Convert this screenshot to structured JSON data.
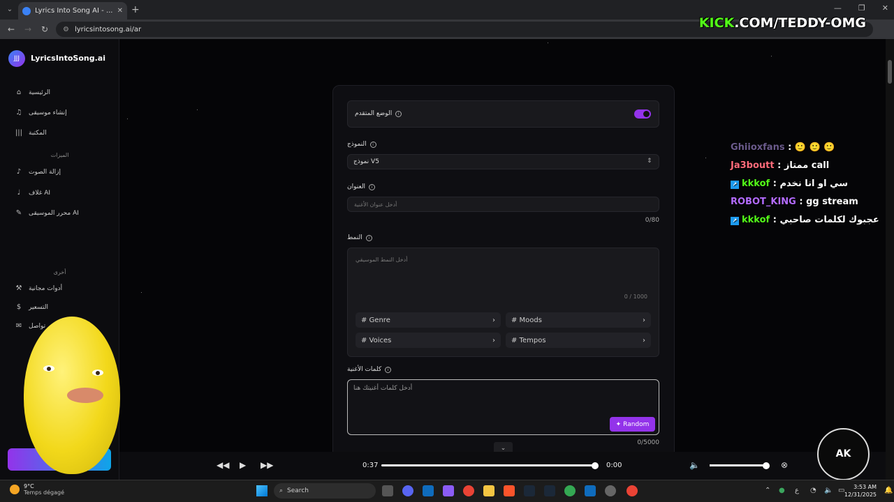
{
  "browser": {
    "tab_title": "Lyrics Into Song AI - ...بر الإنترنت",
    "url": "lyricsintosong.ai/ar"
  },
  "overlay": {
    "kick_prefix": "KICK",
    "kick_suffix": ".COM/TEDDY-OMG",
    "eagle_text": "AK"
  },
  "sidebar": {
    "brand": "LyricsIntoSong.ai",
    "logo": "JJJ",
    "items": [
      {
        "label": "الرئيسية",
        "icon": "home-icon"
      },
      {
        "label": "إنشاء موسيقى",
        "icon": "music-icon"
      },
      {
        "label": "المكتبة",
        "icon": "library-icon"
      }
    ],
    "features_heading": "الميزات",
    "features": [
      {
        "label": "إزالة الصوت",
        "icon": "vocal-remover-icon"
      },
      {
        "label": "غلاف AI",
        "icon": "cover-icon"
      },
      {
        "label": "محرر الموسيقى AI",
        "icon": "editor-icon"
      }
    ],
    "other_heading": "أخرى",
    "other": [
      {
        "label": "أدوات مجانية",
        "icon": "tools-icon"
      },
      {
        "label": "التسعير",
        "icon": "dollar-icon"
      },
      {
        "label": "تواصل",
        "icon": "mail-icon"
      }
    ]
  },
  "form": {
    "advanced_mode_label": "الوضع المتقدم",
    "advanced_mode_on": true,
    "model_label": "النموذج",
    "model_value": "نموذج V5",
    "title_label": "العنوان",
    "title_placeholder": "أدخل عنوان الأغنية",
    "title_count": "0/80",
    "style_label": "النمط",
    "style_placeholder": "أدخل النمط الموسيقي",
    "style_count": "0 / 1000",
    "chips": [
      "# Genre",
      "# Moods",
      "# Voices",
      "# Tempos"
    ],
    "lyrics_label": "كلمات الأغنية",
    "lyrics_placeholder": "أدخل كلمات أغنيتك هنا",
    "random_label": "Random",
    "lyrics_count": "0/5000"
  },
  "player": {
    "current_time": "0:37",
    "end_time": "0:00",
    "progress": 1.0,
    "volume": 0.93
  },
  "chat": [
    {
      "user": "Ghiioxfans",
      "color": "#6b5b8c",
      "message": "🙂 🙂 🙂",
      "badge": false
    },
    {
      "user": "Ja3boutt",
      "color": "#ff6b7a",
      "message": "ممتاز call",
      "badge": false
    },
    {
      "user": "kkkof",
      "color": "#53fc18",
      "message": "سي او انا نخدم",
      "badge": true
    },
    {
      "user": "ROBOT_KING",
      "color": "#b36bff",
      "message": "gg stream",
      "badge": false
    },
    {
      "user": "kkkof",
      "color": "#53fc18",
      "message": "عجبوك لكلمات صاحبي",
      "badge": true
    }
  ],
  "taskbar": {
    "temperature": "9°C",
    "weather": "Temps dégagé",
    "search_label": "Search",
    "time": "3:53 AM",
    "date": "12/31/2025",
    "language": "ع"
  },
  "colors": {
    "accent": "#9333ea",
    "kick_green": "#53fc18"
  }
}
